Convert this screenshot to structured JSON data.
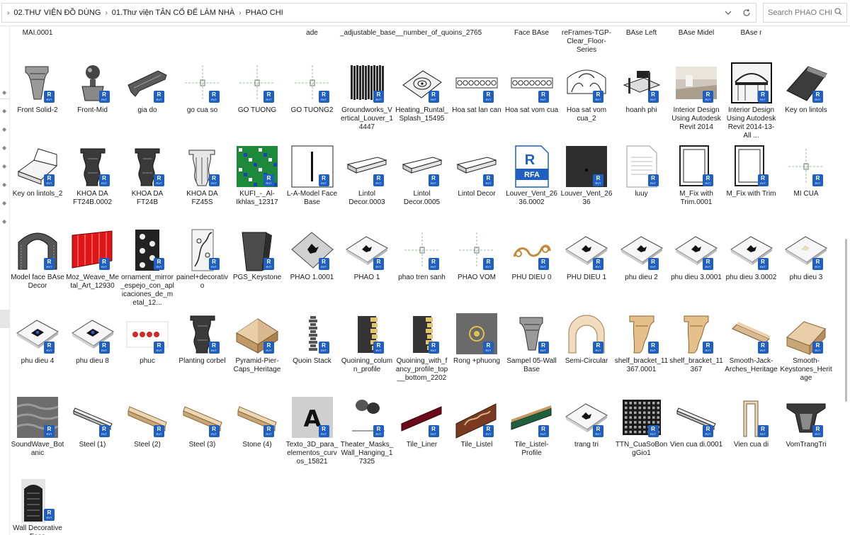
{
  "breadcrumb": [
    "02.THƯ VIỆN ĐỒ DÙNG",
    "01.Thư viện TÂN CỔ ĐỂ LÀM NHÀ",
    "PHAO CHI"
  ],
  "search": {
    "placeholder": "Search PHAO CHI"
  },
  "badge": {
    "letter": "R",
    "sub": "RVT"
  },
  "previous_row_labels": [
    "MAI.0001",
    "",
    "",
    "",
    "",
    "ade",
    "_adjustable_base__number_of_quoins_2765",
    "",
    "",
    "Face BAse",
    "reFrames-TGP-Clear_Floor-Series",
    "BAse Left",
    "BAse Midel",
    "BAse r"
  ],
  "items": [
    {
      "name": "Front Solid-2",
      "icon": "corbel"
    },
    {
      "name": "Front-Mid",
      "icon": "finial"
    },
    {
      "name": "gia do",
      "icon": "bracket"
    },
    {
      "name": "go cua so",
      "icon": "crosshair"
    },
    {
      "name": "GO TUONG",
      "icon": "crosshair"
    },
    {
      "name": "GO TUONG2",
      "icon": "crosshair"
    },
    {
      "name": "Groundworks_Vertical_Louver_14447",
      "icon": "louver"
    },
    {
      "name": "Heating_Runtal_Splash_15495",
      "icon": "panel-round"
    },
    {
      "name": "Hoa sat lan can",
      "icon": "railing"
    },
    {
      "name": "Hoa sat vom cua",
      "icon": "railing"
    },
    {
      "name": "Hoa sat vom cua_2",
      "icon": "arch-grille"
    },
    {
      "name": "hoanh phi",
      "icon": "board"
    },
    {
      "name": "Interior Design Using Autodesk Revit 2014",
      "icon": "photo"
    },
    {
      "name": "Interior Design Using Autodesk Revit 2014-13-All ...",
      "icon": "photo-arch"
    },
    {
      "name": "Key on lintols",
      "icon": "wedge"
    },
    {
      "name": "Key on lintols_2",
      "icon": "wedge-white"
    },
    {
      "name": "KHOA DA FT24B.0002",
      "icon": "corbel-dark"
    },
    {
      "name": "KHOA DA FT24B",
      "icon": "corbel-dark"
    },
    {
      "name": "KHOA DA FZ45S",
      "icon": "corbel-light"
    },
    {
      "name": "KUFI_-_Al-Ikhlas_12317",
      "icon": "kufi"
    },
    {
      "name": "L-A-Model Face Base",
      "icon": "stick"
    },
    {
      "name": "Lintol Decor.0003",
      "icon": "beam"
    },
    {
      "name": "Lintol Decor.0005",
      "icon": "beam"
    },
    {
      "name": "Lintol Decor",
      "icon": "beam"
    },
    {
      "name": "Louver_Vent_2636.0002",
      "icon": "rfa"
    },
    {
      "name": "Louver_Vent_2636",
      "icon": "vent"
    },
    {
      "name": "luuy",
      "icon": "document"
    },
    {
      "name": "M_Fix with Trim.0001",
      "icon": "window"
    },
    {
      "name": "M_Fix with Trim",
      "icon": "window"
    },
    {
      "name": "MI CUA",
      "icon": "crosshair"
    },
    {
      "name": "Model face BAse Decor",
      "icon": "arch"
    },
    {
      "name": "Moz_Weave_Metal_Art_12930",
      "icon": "weave"
    },
    {
      "name": "ornament_mirror_espejo_con_aplicaciones_de_metal_12...",
      "icon": "ornament"
    },
    {
      "name": "painel+decorativo",
      "icon": "vine-panel"
    },
    {
      "name": "PGS_Keystone",
      "icon": "keystone"
    },
    {
      "name": "PHAO 1.0001",
      "icon": "tile-gray"
    },
    {
      "name": "PHAO 1",
      "icon": "tile"
    },
    {
      "name": "phao tren sanh",
      "icon": "crosshair"
    },
    {
      "name": "PHAO VOM",
      "icon": "crosshair"
    },
    {
      "name": "PHU DIEU 0",
      "icon": "scroll"
    },
    {
      "name": "PHU DIEU 1",
      "icon": "tile"
    },
    {
      "name": "phu dieu 2",
      "icon": "tile"
    },
    {
      "name": "phu dieu 3.0001",
      "icon": "tile"
    },
    {
      "name": "phu dieu 3.0002",
      "icon": "tile"
    },
    {
      "name": "phu dieu 3",
      "icon": "tile-cream"
    },
    {
      "name": "phu dieu 4",
      "icon": "tile-blue"
    },
    {
      "name": "phu dieu 8",
      "icon": "tile-blue"
    },
    {
      "name": "phuc",
      "icon": "phuc"
    },
    {
      "name": "Planting corbel",
      "icon": "corbel-dark"
    },
    {
      "name": "Pyramid-Pier-Caps_Heritage",
      "icon": "pyramid"
    },
    {
      "name": "Quoin Stack",
      "icon": "quoin"
    },
    {
      "name": "Quoining_column_profile",
      "icon": "column"
    },
    {
      "name": "Quoining_with_fancy_profile_top__bottom_2202",
      "icon": "column"
    },
    {
      "name": "Rong +phuong",
      "icon": "rong"
    },
    {
      "name": "Sampel 05-Wall Base",
      "icon": "corbel"
    },
    {
      "name": "Semi-Circular",
      "icon": "semicircle"
    },
    {
      "name": "shelf_bracket_11367.0001",
      "icon": "shelf"
    },
    {
      "name": "shelf_bracket_11367",
      "icon": "shelf"
    },
    {
      "name": "Smooth-Jack-Arches_Heritage",
      "icon": "jack-arch"
    },
    {
      "name": "Smooth-Keystones_Heritage",
      "icon": "wedge-tan"
    },
    {
      "name": "SoundWave_Botanic",
      "icon": "soundwave"
    },
    {
      "name": "Steel (1)",
      "icon": "rod"
    },
    {
      "name": "Steel (2)",
      "icon": "rod-tan"
    },
    {
      "name": "Steel (3)",
      "icon": "rod-tan"
    },
    {
      "name": "Stone (4)",
      "icon": "rod-tan"
    },
    {
      "name": "Texto_3D_para_elementos_curvos_15821",
      "icon": "letter-a"
    },
    {
      "name": "Theater_Masks_Wall_Hanging_17325",
      "icon": "masks"
    },
    {
      "name": "Tile_Liner",
      "icon": "liner"
    },
    {
      "name": "Tile_Listel",
      "icon": "listel"
    },
    {
      "name": "Tile_Listel-Profile",
      "icon": "listel-profile"
    },
    {
      "name": "trang tri",
      "icon": "tile"
    },
    {
      "name": "TTN_CuaSoBongGio1",
      "icon": "breeze-block"
    },
    {
      "name": "Vien cua di.0001",
      "icon": "rod"
    },
    {
      "name": "Vien cua di",
      "icon": "door-frame"
    },
    {
      "name": "VomTrangTri",
      "icon": "hood"
    },
    {
      "name": "Wall Decorative Face",
      "icon": "wall-face"
    }
  ]
}
